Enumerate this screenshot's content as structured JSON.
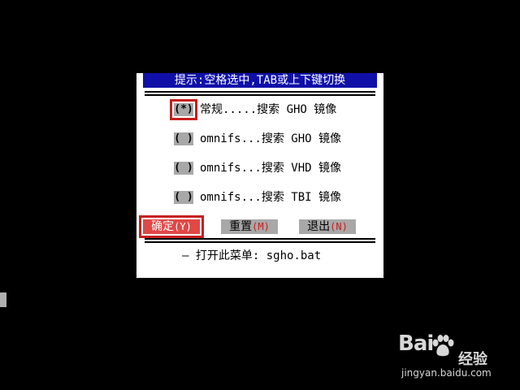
{
  "dialog": {
    "title": "提示:空格选中,TAB或上下键切换",
    "options": [
      {
        "marker": "(*)",
        "label": "常规.....搜索 GHO 镜像",
        "selected": true
      },
      {
        "marker": "( )",
        "label": "omnifs...搜索 GHO 镜像",
        "selected": false
      },
      {
        "marker": "( )",
        "label": "omnifs...搜索 VHD 镜像",
        "selected": false
      },
      {
        "marker": "( )",
        "label": "omnifs...搜索 TBI 镜像",
        "selected": false
      }
    ],
    "buttons": {
      "ok": {
        "label": "确定",
        "hotkey": "(Y)"
      },
      "reset": {
        "label": "重置",
        "hotkey": "(M)"
      },
      "exit": {
        "label": "退出",
        "hotkey": "(N)"
      }
    },
    "footer": "–  打开此菜单: sgho.bat"
  },
  "watermark": {
    "logo": "Bai  ",
    "cn": "经验",
    "url": "jingyan.baidu.com"
  },
  "colors": {
    "title_bg": "#1010a8",
    "highlight_red": "#c81e1e",
    "button_gray": "#a8a8a8",
    "ok_button_bg": "#e04848"
  }
}
